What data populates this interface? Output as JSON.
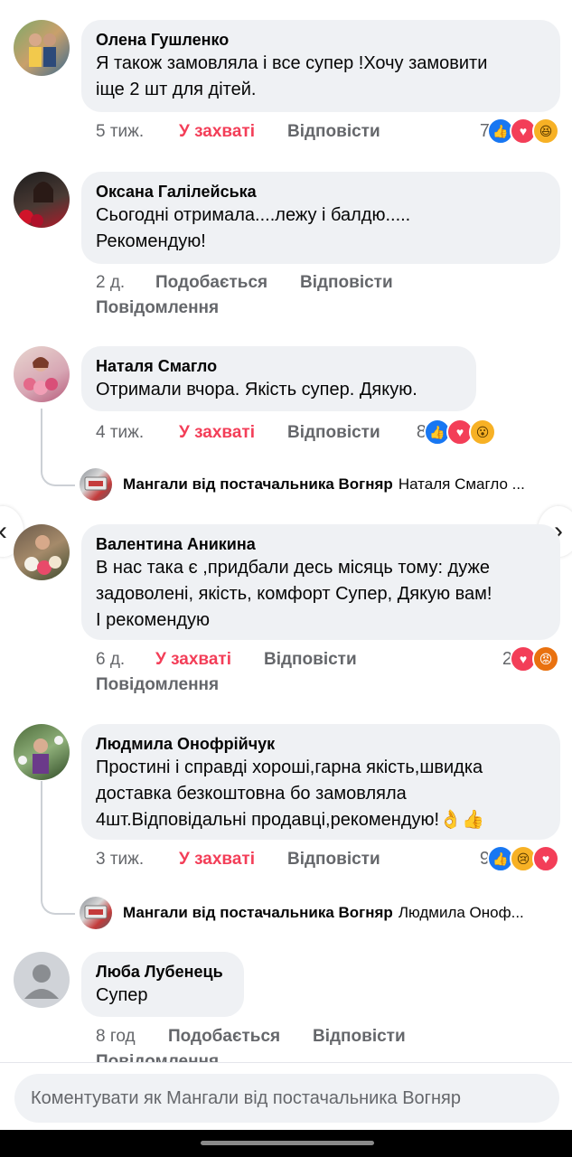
{
  "comments": [
    {
      "author": "Олена Гушленко",
      "text": "Я також замовляла і все супер !Хочу замовити\nіще 2 шт для дітей.",
      "time": "5 тиж.",
      "reaction_label": "У захваті",
      "reply_label": "Відповісти",
      "reaction_count": "7",
      "reactions": [
        "like",
        "love",
        "haha"
      ]
    },
    {
      "author": "Оксана Галілейська",
      "text": "Сьогодні отримала....лежу і балдю.....\nРекомендую!",
      "time": "2 д.",
      "reaction_label": "Подобається",
      "reply_label": "Відповісти",
      "message_label": "Повідомлення"
    },
    {
      "author": "Наталя Смагло",
      "text": "Отримали вчора. Якість супер. Дякую.",
      "time": "4 тиж.",
      "reaction_label": "У захваті",
      "reply_label": "Відповісти",
      "reaction_count": "8",
      "reactions": [
        "like",
        "love",
        "wow"
      ],
      "reply": {
        "author": "Мангали від постачальника Вогняр",
        "text": "Наталя Смагло ..."
      }
    },
    {
      "author": "Валентина Аникина",
      "text": "В нас така є ,придбали десь місяць тому: дуже\nзадоволені, якість, комфорт Супер, Дякую вам!\nІ рекомендую",
      "time": "6 д.",
      "reaction_label": "У захваті",
      "reply_label": "Відповісти",
      "message_label": "Повідомлення",
      "reaction_count": "2",
      "reactions": [
        "love",
        "angry"
      ]
    },
    {
      "author": "Людмила Онофрійчук",
      "text": "Простині і справді хороші,гарна якість,швидка\nдоставка безкоштовна бо замовляла\n4шт.Відповідальні продавці,рекомендую!👌👍",
      "time": "3 тиж.",
      "reaction_label": "У захваті",
      "reply_label": "Відповісти",
      "reaction_count": "9",
      "reactions": [
        "like",
        "sad",
        "love"
      ],
      "reply": {
        "author": "Мангали від постачальника Вогняр",
        "text": "Людмила Оноф..."
      }
    },
    {
      "author": "Люба Лубенець",
      "text": "Супер",
      "time": "8 год",
      "reaction_label": "Подобається",
      "reply_label": "Відповісти",
      "message_label": "Повідомлення"
    }
  ],
  "composer": {
    "placeholder": "Коментувати як Мангали від постачальника Вогняр"
  },
  "nav": {
    "prev_icon": "chevron-left-icon",
    "next_icon": "chevron-right-icon"
  },
  "colors": {
    "love_label": "#f33e58",
    "bubble": "#eff1f4",
    "like": "#1877f2"
  }
}
